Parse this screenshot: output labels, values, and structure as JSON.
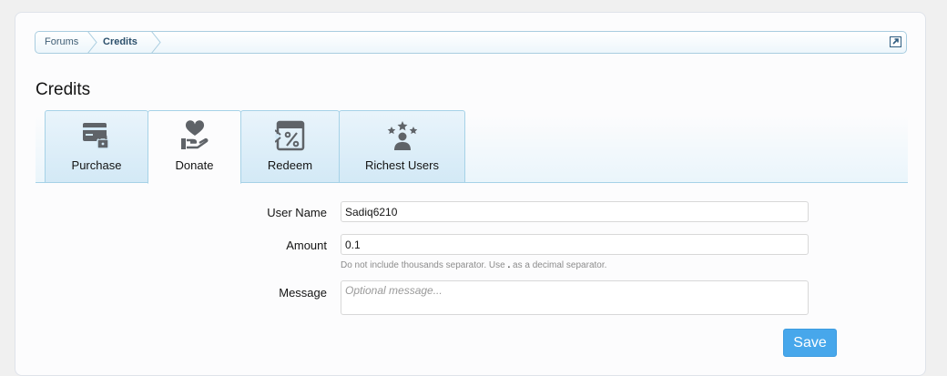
{
  "breadcrumb": {
    "items": [
      "Forums",
      "Credits"
    ]
  },
  "page_title": "Credits",
  "tabs": [
    {
      "label": "Purchase",
      "icon": "credit-card-lock-icon",
      "active": false
    },
    {
      "label": "Donate",
      "icon": "heart-hand-icon",
      "active": true
    },
    {
      "label": "Redeem",
      "icon": "coupon-percent-icon",
      "active": false
    },
    {
      "label": "Richest Users",
      "icon": "user-stars-icon",
      "active": false
    }
  ],
  "form": {
    "username_label": "User Name",
    "username_value": "Sadiq6210",
    "amount_label": "Amount",
    "amount_value": "0.1",
    "amount_hint_pre": "Do not include thousands separator. Use",
    "amount_hint_sym": ".",
    "amount_hint_post": "as a decimal separator.",
    "message_label": "Message",
    "message_placeholder": "Optional message...",
    "save_label": "Save"
  },
  "colors": {
    "accent": "#47a7eb",
    "tab_border": "#a6d2e7",
    "icon": "#5f6368"
  }
}
